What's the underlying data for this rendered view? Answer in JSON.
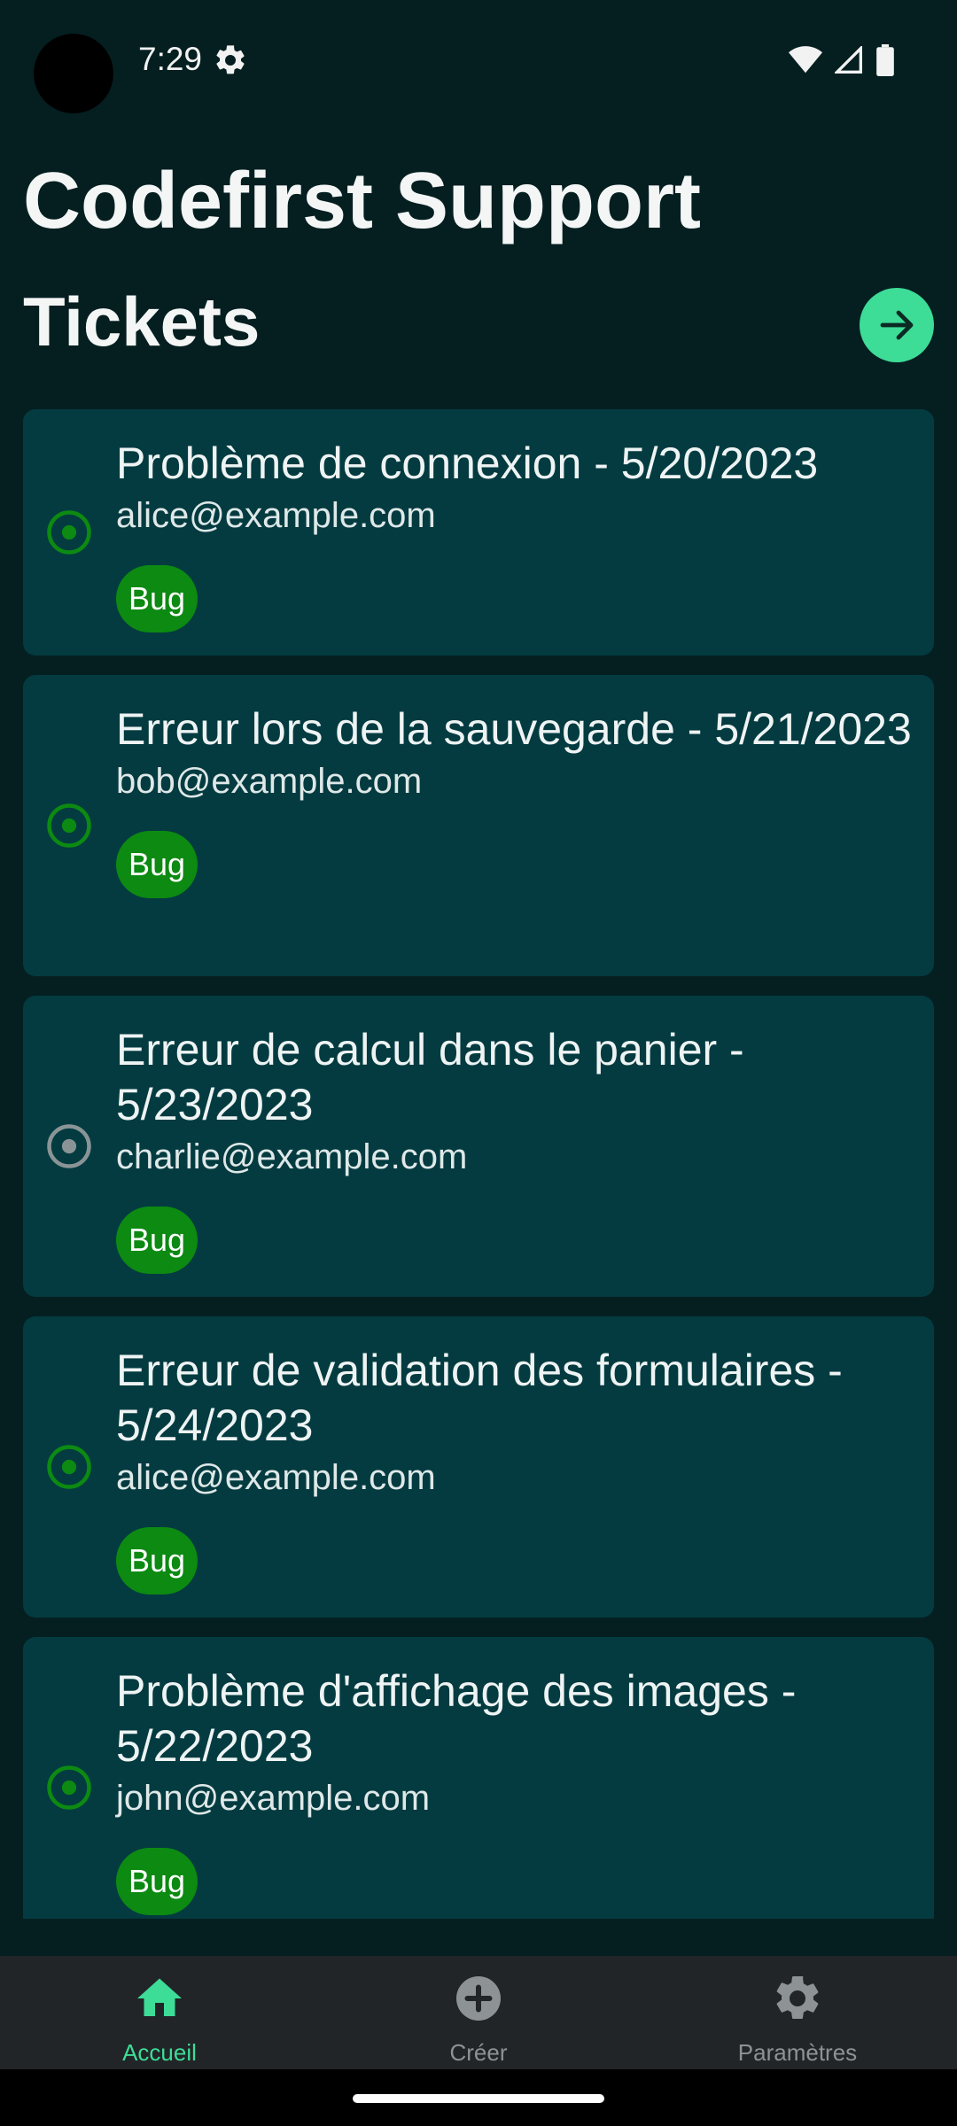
{
  "status_bar": {
    "time": "7:29",
    "icons": [
      "settings-gear-icon",
      "wifi-icon",
      "signal-icon",
      "battery-icon"
    ]
  },
  "app": {
    "title": "Codefirst Support",
    "section_title": "Tickets",
    "go_button_icon": "arrow-right-icon"
  },
  "tickets": [
    {
      "title": "Problème de connexion - 5/20/2023",
      "email": "alice@example.com",
      "tag": "Bug",
      "status_color": "#0c8a12"
    },
    {
      "title": "Erreur lors de la sauvegarde - 5/21/2023",
      "email": "bob@example.com",
      "tag": "Bug",
      "status_color": "#0c8a12"
    },
    {
      "title": "Erreur de calcul dans le panier - 5/23/2023",
      "email": "charlie@example.com",
      "tag": "Bug",
      "status_color": "#8a9496"
    },
    {
      "title": "Erreur de validation des formulaires - 5/24/2023",
      "email": "alice@example.com",
      "tag": "Bug",
      "status_color": "#0c8a12"
    },
    {
      "title": "Problème d'affichage des images - 5/22/2023",
      "email": "john@example.com",
      "tag": "Bug",
      "status_color": "#0c8a12"
    }
  ],
  "bottom_nav": {
    "items": [
      {
        "label": "Accueil",
        "icon": "home-icon",
        "active": true
      },
      {
        "label": "Créer",
        "icon": "add-circle-icon",
        "active": false
      },
      {
        "label": "Paramètres",
        "icon": "settings-gear-icon",
        "active": false
      }
    ]
  },
  "colors": {
    "background": "#051f21",
    "card": "#033b40",
    "accent": "#3ddc97",
    "tag": "#0c8a12",
    "nav_background": "#222528"
  }
}
